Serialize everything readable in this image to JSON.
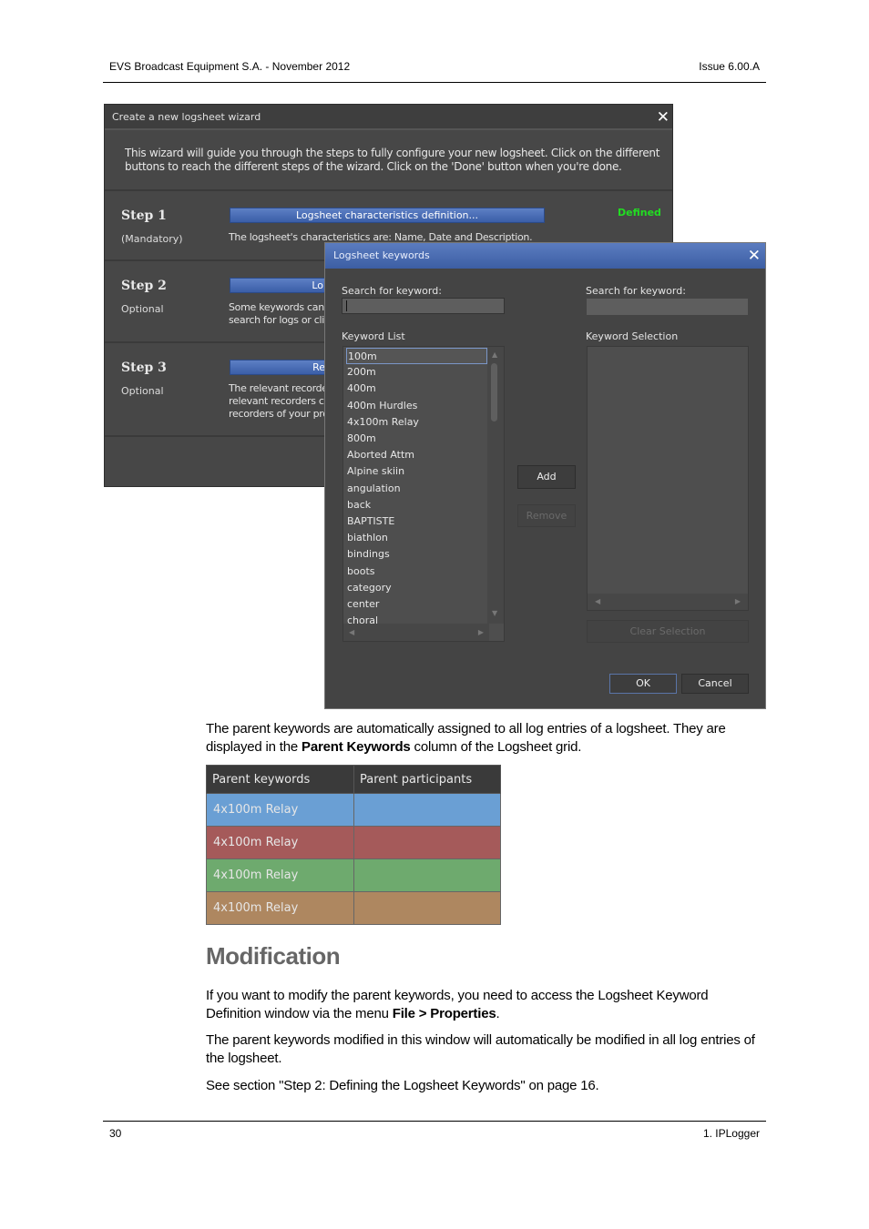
{
  "header": {
    "left": "EVS Broadcast Equipment S.A.  - November 2012",
    "right": "Issue 6.00.A"
  },
  "wizard": {
    "title": "Create a new logsheet wizard",
    "intro": "This wizard will guide you through the steps to fully configure your new logsheet. Click on the different buttons to reach the different steps of the wizard. Click on the 'Done' button when you're done.",
    "steps": [
      {
        "label": "Step 1",
        "sub": "(Mandatory)",
        "button": "Logsheet characteristics definition...",
        "desc1": "The logsheet's characteristics are: Name, Date and Description.",
        "desc2": "",
        "desc3": "",
        "status": "Defined"
      },
      {
        "label": "Step 2",
        "sub": "Optional",
        "button": "Lo",
        "desc1": "Some keywords can",
        "desc2": "search for logs or cli",
        "desc3": ""
      },
      {
        "label": "Step 3",
        "sub": "Optional",
        "button": "Re",
        "desc1": "The relevant recorde",
        "desc2": "relevant recorders ca",
        "desc3": "recorders of your pro"
      }
    ],
    "status_color": "#22dd22"
  },
  "dialog": {
    "title": "Logsheet keywords",
    "search_left_label": "Search for keyword:",
    "search_left_value": "",
    "search_right_label": "Search for keyword:",
    "search_right_value": "",
    "list_label": "Keyword List",
    "selection_label": "Keyword Selection",
    "keywords": [
      "100m",
      "200m",
      "400m",
      "400m Hurdles",
      "4x100m Relay",
      "800m",
      "Aborted Attm",
      "Alpine skiin",
      "angulation",
      "back",
      "BAPTISTE",
      "biathlon",
      "bindings",
      "boots",
      "category",
      "center",
      "choral"
    ],
    "selected_keyword": "100m",
    "add": "Add",
    "remove": "Remove",
    "clear": "Clear Selection",
    "ok": "OK",
    "cancel": "Cancel"
  },
  "para1": {
    "a": "The parent keywords are automatically assigned to all log entries of a logsheet. They are displayed in the ",
    "b": "Parent Keywords",
    "c": " column of the Logsheet grid."
  },
  "grid": {
    "headers": [
      "Parent keywords",
      "Parent participants"
    ],
    "rows": [
      {
        "kw": "4x100m Relay",
        "pp": "",
        "color": "#6a9fd4"
      },
      {
        "kw": "4x100m Relay",
        "pp": "",
        "color": "#a55a5a"
      },
      {
        "kw": "4x100m Relay",
        "pp": "",
        "color": "#6eaa6e"
      },
      {
        "kw": "4x100m Relay",
        "pp": "",
        "color": "#ae8760"
      }
    ]
  },
  "section": {
    "title": "Modification",
    "p1a": "If you want to modify the parent keywords, you need to access the Logsheet Keyword Definition window via the menu ",
    "p1b": "File > Properties",
    "p1c": ".",
    "p2": "The parent keywords modified in this window will automatically be modified in all log entries of the logsheet.",
    "p3": "See section \"Step 2: Defining the Logsheet Keywords\" on page 16."
  },
  "footer": {
    "left": "30",
    "right": "1. IPLogger"
  }
}
